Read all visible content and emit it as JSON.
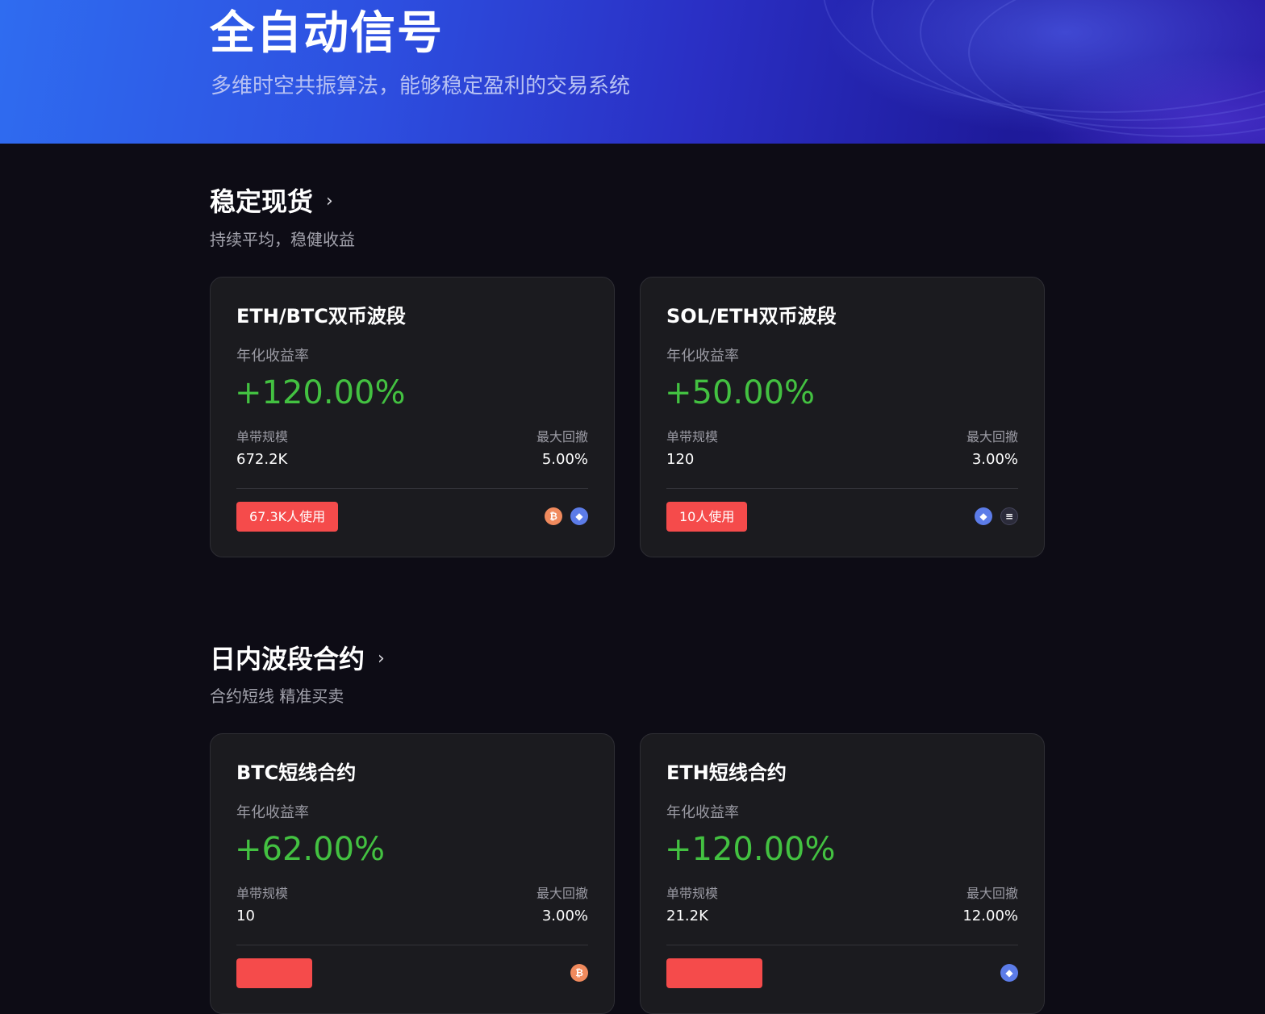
{
  "hero": {
    "title": "全自动信号",
    "subtitle": "多维时空共振算法，能够稳定盈利的交易系统"
  },
  "sections": [
    {
      "title": "稳定现货",
      "subtitle": "持续平均，稳健收益",
      "cards": [
        {
          "name": "ETH/BTC双币波段",
          "metric_label": "年化收益率",
          "metric_value": "+120.00%",
          "scale_label": "单带规模",
          "scale_value": "672.2K",
          "drawdown_label": "最大回撤",
          "drawdown_value": "5.00%",
          "users": "67.3K人使用",
          "coins": [
            "btc-icon",
            "eth-icon"
          ]
        },
        {
          "name": "SOL/ETH双币波段",
          "metric_label": "年化收益率",
          "metric_value": "+50.00%",
          "scale_label": "单带规模",
          "scale_value": "120",
          "drawdown_label": "最大回撤",
          "drawdown_value": "3.00%",
          "users": "10人使用",
          "coins": [
            "eth-icon",
            "sol-icon"
          ]
        }
      ]
    },
    {
      "title": "日内波段合约",
      "subtitle": "合约短线 精准买卖",
      "cards": [
        {
          "name": "BTC短线合约",
          "metric_label": "年化收益率",
          "metric_value": "+62.00%",
          "scale_label": "单带规模",
          "scale_value": "10",
          "drawdown_label": "最大回撤",
          "drawdown_value": "3.00%",
          "users": "",
          "coins": [
            "btc-icon"
          ]
        },
        {
          "name": "ETH短线合约",
          "metric_label": "年化收益率",
          "metric_value": "+120.00%",
          "scale_label": "单带规模",
          "scale_value": "21.2K",
          "drawdown_label": "最大回撤",
          "drawdown_value": "12.00%",
          "users": "",
          "coins": [
            "eth-icon"
          ]
        }
      ]
    }
  ],
  "colors": {
    "positive": "#43c141",
    "badge": "#f54b4b",
    "card_bg": "#1b1b1f",
    "page_bg": "#0d0c15"
  }
}
